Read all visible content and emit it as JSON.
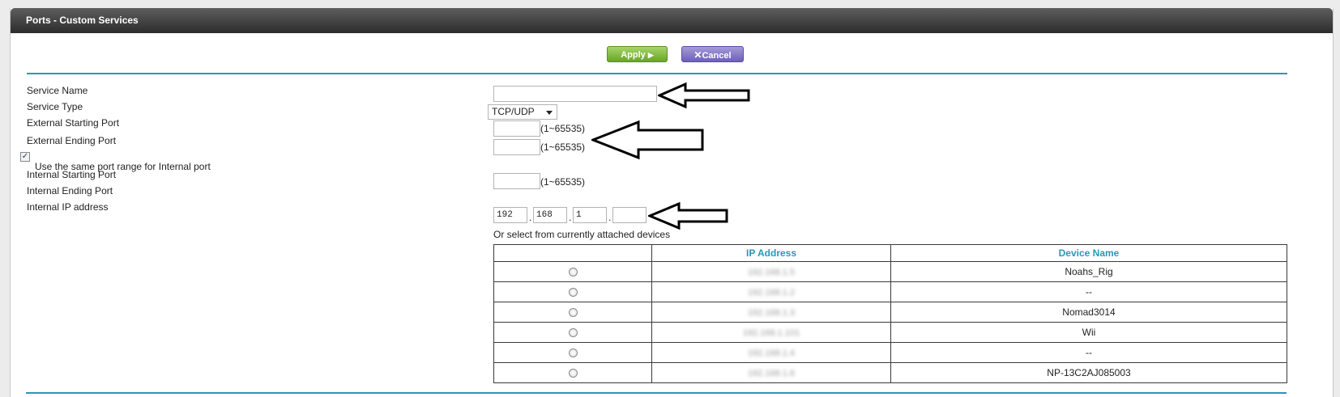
{
  "page": {
    "title": "Ports - Custom Services"
  },
  "toolbar": {
    "apply_label": "Apply",
    "apply_icon": "play-triangle-icon",
    "cancel_label": "Cancel",
    "cancel_icon": "x-icon"
  },
  "form": {
    "service_name": {
      "label": "Service Name",
      "value": ""
    },
    "service_type": {
      "label": "Service Type",
      "value": "TCP/UDP"
    },
    "external_start": {
      "label": "External Starting Port",
      "value": "",
      "hint": "(1~65535)"
    },
    "external_end": {
      "label": "External Ending Port",
      "value": "",
      "hint": "(1~65535)"
    },
    "same_range": {
      "label": "Use the same port range for Internal port",
      "checked": true
    },
    "internal_start": {
      "label": "Internal Starting Port",
      "value": "",
      "hint": "(1~65535)"
    },
    "internal_end": {
      "label": "Internal Ending Port"
    },
    "internal_ip": {
      "label": "Internal IP address",
      "octets": [
        "192",
        "168",
        "1",
        ""
      ],
      "separator": "."
    },
    "select_hint": "Or select from currently attached devices"
  },
  "devices": {
    "headers": [
      "",
      "IP Address",
      "Device Name"
    ],
    "rows": [
      {
        "ip": "192.168.1.5",
        "name": "Noahs_Rig"
      },
      {
        "ip": "192.168.1.2",
        "name": "--"
      },
      {
        "ip": "192.168.1.3",
        "name": "Nomad3014"
      },
      {
        "ip": "192.168.1.101",
        "name": "Wii"
      },
      {
        "ip": "192.168.1.4",
        "name": "--"
      },
      {
        "ip": "192.168.1.6",
        "name": "NP-13C2AJ085003"
      }
    ]
  },
  "colors": {
    "accent": "#2a97b8",
    "apply_green": "#6aa428",
    "cancel_purple": "#6d60b8",
    "titlebar": "#3a3a3a"
  }
}
